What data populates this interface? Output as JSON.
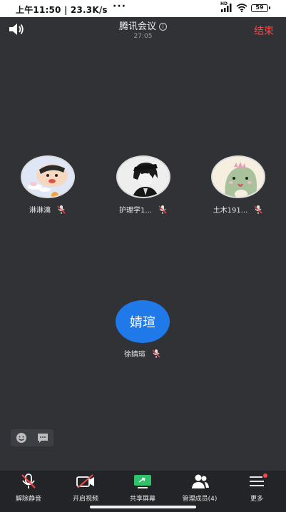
{
  "status_bar": {
    "time": "上午11:50 | 23.3K/s",
    "dots": "···",
    "network_label": "HD",
    "battery": "59"
  },
  "meeting": {
    "title": "腾讯会议",
    "duration": "27:05",
    "end_label": "结束",
    "info_glyph": "i"
  },
  "participants": [
    {
      "name": "淋淋漓",
      "avatar_icon": "crayon-shin-chan-avatar",
      "muted": true
    },
    {
      "name": "护理学1...",
      "avatar_icon": "anime-boy-avatar",
      "muted": true
    },
    {
      "name": "土木191...",
      "avatar_icon": "dinosaur-avatar",
      "muted": true
    }
  ],
  "self": {
    "avatar_text": "婧瑄",
    "name": "徐婧瑄",
    "avatar_color": "#1f79e8",
    "muted": true
  },
  "toolbar": {
    "unmute": "解除静音",
    "video": "开启视频",
    "share": "共享屏幕",
    "members": "管理成员(4)",
    "more": "更多"
  },
  "colors": {
    "background": "#303236",
    "accent_blue": "#1f79e8",
    "end_red": "#f04a4a",
    "share_green": "#2fc26b",
    "badge_red": "#f04a4a"
  }
}
